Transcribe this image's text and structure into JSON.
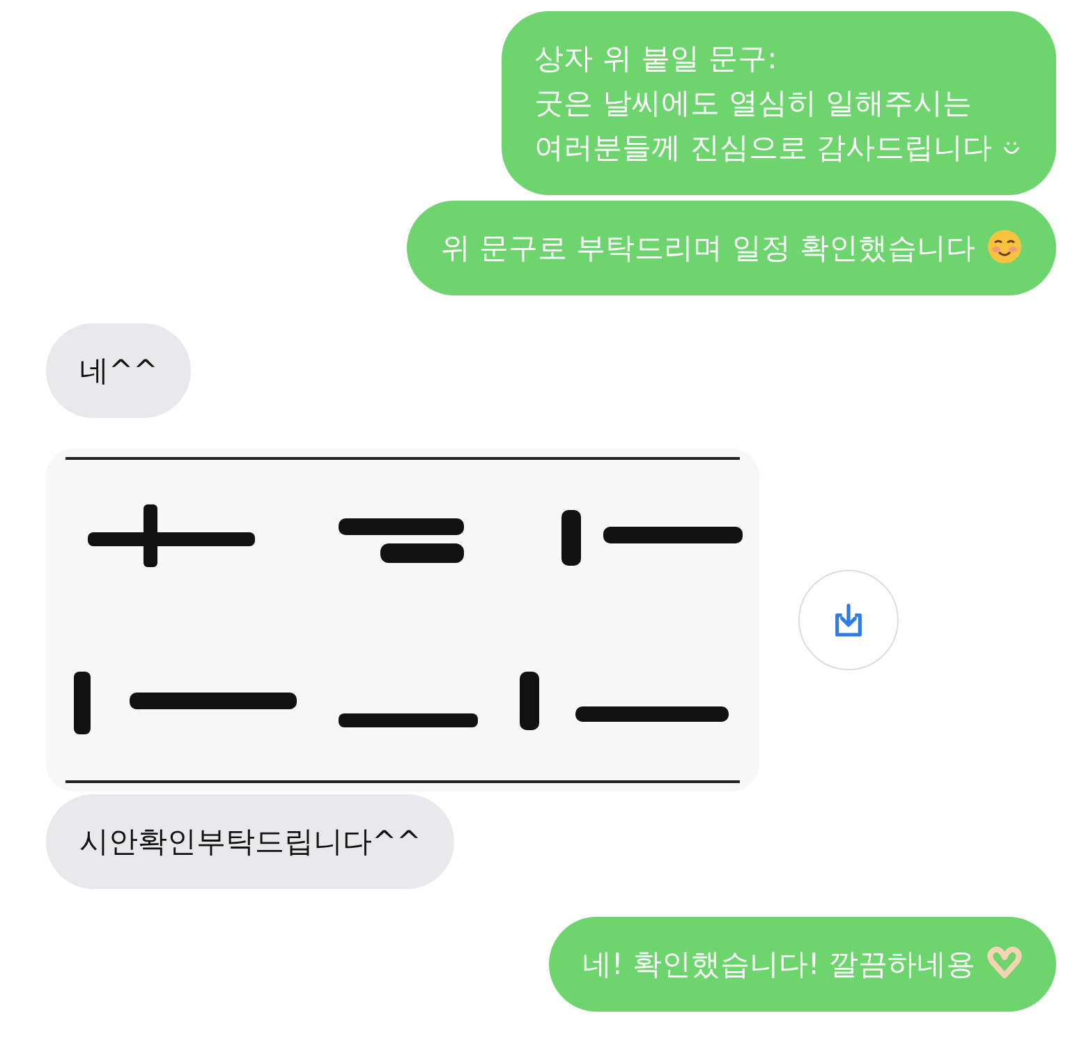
{
  "messages": [
    {
      "kind": "outgoing",
      "text": "상자 위 붙일 문구:\n굿은 날씨에도 열심히 일해주시는\n여러분들께 진심으로 감사드립니다",
      "emoji": {
        "kind": "smile"
      }
    },
    {
      "kind": "outgoing",
      "text": "위 문구로 부탁드리며 일정 확인했습니다",
      "emoji": {
        "kind": "blush"
      }
    },
    {
      "kind": "incoming",
      "text": "네^^"
    },
    {
      "kind": "incoming-image"
    },
    {
      "kind": "incoming",
      "text": "시안확인부탁드립니다^^"
    },
    {
      "kind": "outgoing",
      "text": "네! 확인했습니다! 깔끔하네용",
      "emoji": {
        "kind": "heart-hands"
      }
    }
  ]
}
